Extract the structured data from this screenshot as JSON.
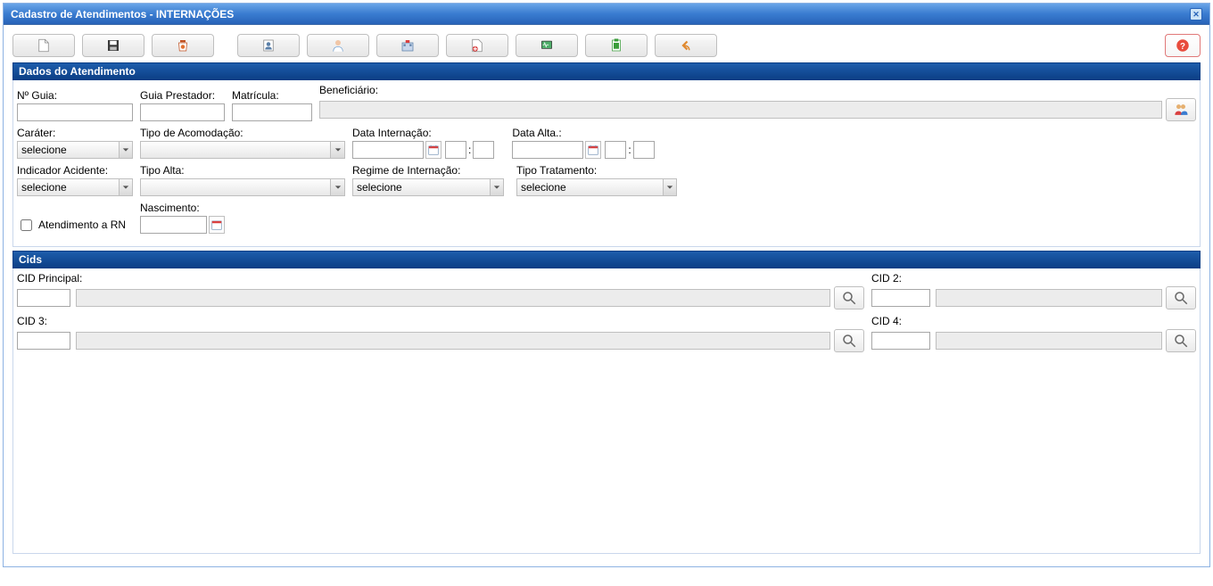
{
  "window": {
    "title": "Cadastro de Atendimentos - INTERNAÇÕES"
  },
  "toolbar": {
    "new": "Novo",
    "save": "Salvar",
    "delete": "Excluir",
    "profile": "Perfil",
    "prof2": "Profissional",
    "hospital": "Hospital",
    "addproc": "Procedimento",
    "monitor": "Monitor",
    "doc": "Documento",
    "back": "Voltar",
    "help": "Ajuda"
  },
  "sections": {
    "dados": "Dados do Atendimento",
    "cids": "Cids"
  },
  "fields": {
    "nguia": "Nº Guia:",
    "guiaprestador": "Guia Prestador:",
    "matricula": "Matrícula:",
    "beneficiario": "Beneficiário:",
    "carater": "Caráter:",
    "tipoacomod": "Tipo de Acomodação:",
    "datainternacao": "Data Internação:",
    "dataalta": "Data Alta.:",
    "indicadoracidente": "Indicador Acidente:",
    "tipoalta": "Tipo Alta:",
    "regimeint": "Regime de Internação:",
    "tipotrat": "Tipo Tratamento:",
    "atendimentorn": "Atendimento a RN",
    "nascimento": "Nascimento:",
    "cidprincipal": "CID Principal:",
    "cid2": "CID 2:",
    "cid3": "CID 3:",
    "cid4": "CID 4:"
  },
  "values": {
    "nguia": "",
    "guiaprestador": "",
    "matricula": "",
    "beneficiario": "",
    "carater": "selecione",
    "tipoacomod": "",
    "datainternacao": "",
    "datainternacao_h": "",
    "datainternacao_m": "",
    "dataalta": "",
    "dataalta_h": "",
    "dataalta_m": "",
    "indicadoracidente": "selecione",
    "tipoalta": "",
    "regimeint": "selecione",
    "tipotrat": "selecione",
    "nascimento": "",
    "cidprincipal_code": "",
    "cidprincipal_desc": "",
    "cid2_code": "",
    "cid2_desc": "",
    "cid3_code": "",
    "cid3_desc": "",
    "cid4_code": "",
    "cid4_desc": ""
  }
}
